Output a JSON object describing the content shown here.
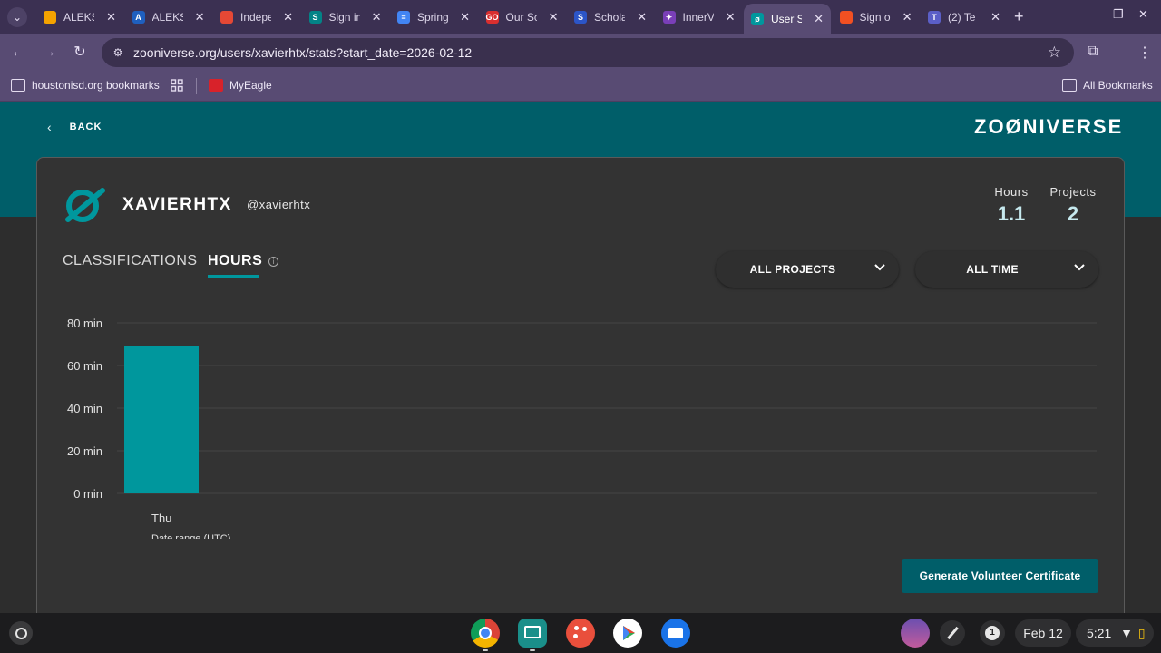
{
  "browser": {
    "tabs": [
      {
        "title": "ALEKS",
        "favicon_color": "#f5a300",
        "favicon_text": ""
      },
      {
        "title": "ALEKS",
        "favicon_color": "#1f5fbf",
        "favicon_text": "A"
      },
      {
        "title": "Indepe",
        "favicon_color": "#e54835",
        "favicon_text": ""
      },
      {
        "title": "Sign in",
        "favicon_color": "#038387",
        "favicon_text": "S"
      },
      {
        "title": "Spring",
        "favicon_color": "#4285f4",
        "favicon_text": "≡"
      },
      {
        "title": "Our Sc",
        "favicon_color": "#d92f2f",
        "favicon_text": "GO"
      },
      {
        "title": "Schola",
        "favicon_color": "#2c55c7",
        "favicon_text": "S"
      },
      {
        "title": "InnerV",
        "favicon_color": "#7a3fb8",
        "favicon_text": "✦"
      },
      {
        "title": "User S",
        "favicon_color": "#00979d",
        "favicon_text": "ø"
      },
      {
        "title": "Sign o",
        "favicon_color": "#f25022",
        "favicon_text": ""
      },
      {
        "title": "(2) Te",
        "favicon_color": "#5b5fc7",
        "favicon_text": "T"
      }
    ],
    "active_tab_index": 8,
    "url": "zooniverse.org/users/xavierhtx/stats?start_date=2026-02-12",
    "bookmarks": [
      {
        "label": "houstonisd.org bookmarks"
      },
      {
        "label": "MyEagle"
      }
    ],
    "all_bookmarks_label": "All Bookmarks"
  },
  "page": {
    "back_label": "BACK",
    "logo": "ZOØNIVERSE",
    "display_name": "XAVIERHTX",
    "handle": "@xavierhtx",
    "stats": [
      {
        "label": "Hours",
        "value": "1.1"
      },
      {
        "label": "Projects",
        "value": "2"
      }
    ],
    "tabs": {
      "classifications": "CLASSIFICATIONS",
      "hours": "HOURS"
    },
    "filters": {
      "project": "ALL PROJECTS",
      "period": "ALL TIME"
    },
    "certificate_button": "Generate Volunteer Certificate"
  },
  "chart_data": {
    "type": "bar",
    "categories": [
      "Thu"
    ],
    "values": [
      69
    ],
    "xlabel": "Date range (UTC)",
    "ylabel": "",
    "ylim": [
      0,
      80
    ],
    "yticks": [
      0,
      20,
      40,
      60,
      80
    ],
    "ytick_suffix": " min",
    "grid": true,
    "bar_color": "#00979d"
  },
  "os_shelf": {
    "date": "Feb 12",
    "time": "5:21",
    "notification_count": "1"
  }
}
